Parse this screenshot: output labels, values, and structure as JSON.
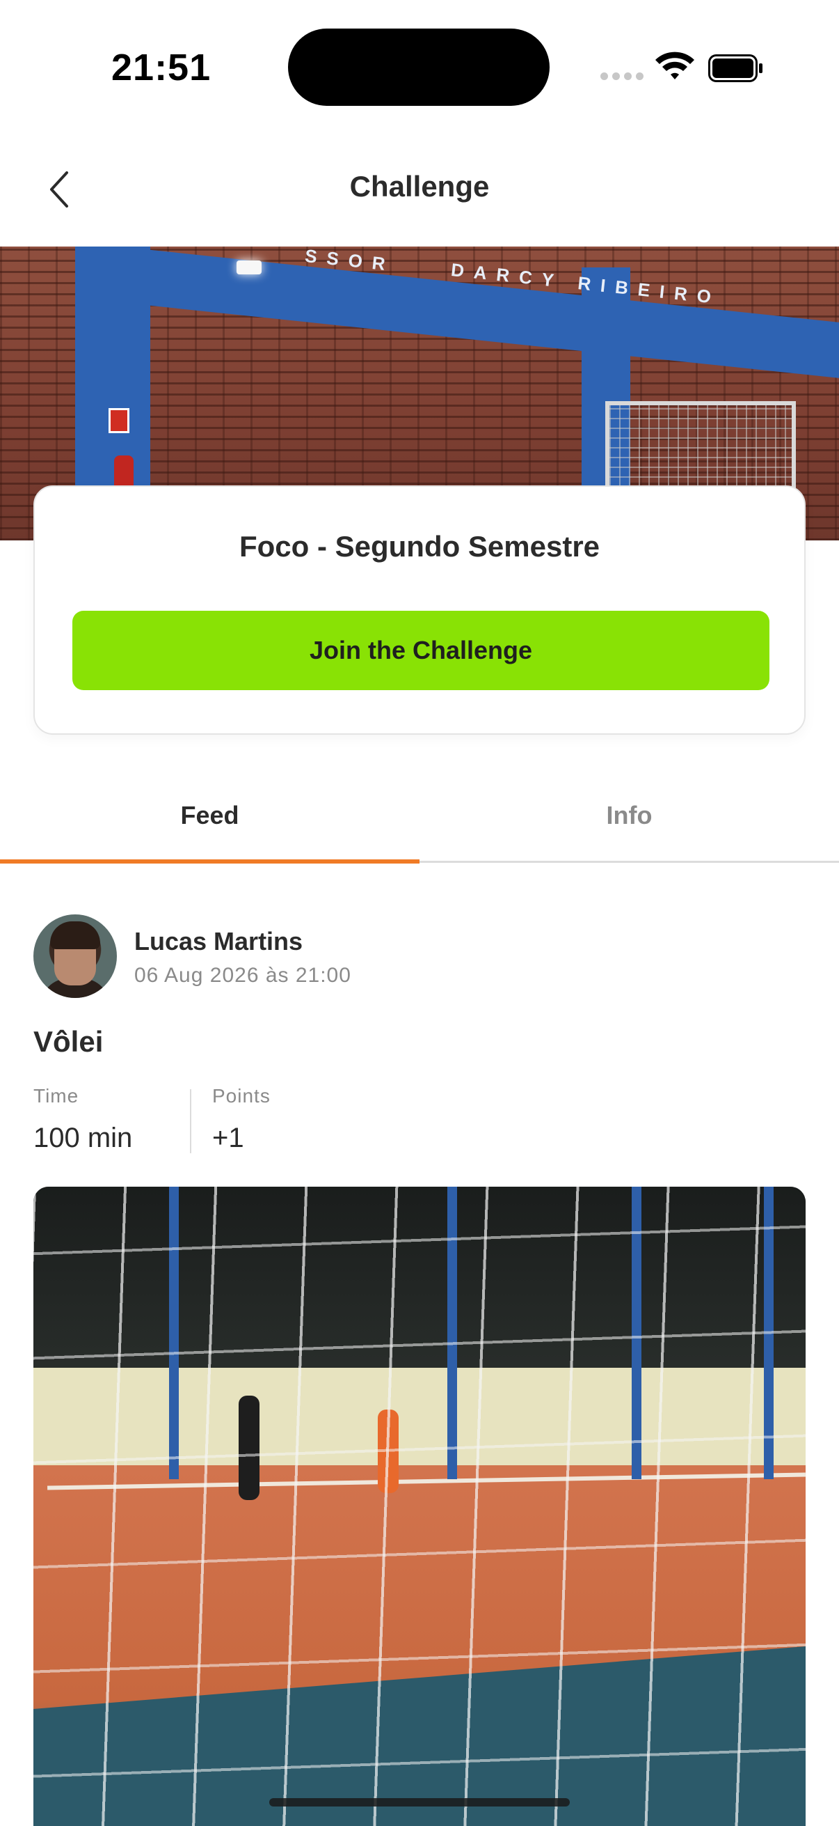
{
  "status_bar": {
    "time": "21:51"
  },
  "nav": {
    "title": "Challenge"
  },
  "hero": {
    "banner_text_left": "SSOR",
    "banner_text_right": "DARCY RIBEIRO"
  },
  "challenge": {
    "name": "Foco - Segundo Semestre",
    "join_label": "Join the Challenge"
  },
  "tabs": [
    {
      "label": "Feed",
      "active": true
    },
    {
      "label": "Info",
      "active": false
    }
  ],
  "post": {
    "user_name": "Lucas Martins",
    "date": "06 Aug 2026 às 21:00",
    "activity": "Vôlei",
    "stats": {
      "time_label": "Time",
      "time_value": "100 min",
      "points_label": "Points",
      "points_value": "+1"
    }
  },
  "colors": {
    "accent_green": "#89e205",
    "tab_active": "#f07b26",
    "hero_blue": "#2e63b3"
  },
  "icons": {
    "back": "chevron-left-icon",
    "wifi": "wifi-icon",
    "battery": "battery-icon",
    "signal": "signal-icon"
  }
}
